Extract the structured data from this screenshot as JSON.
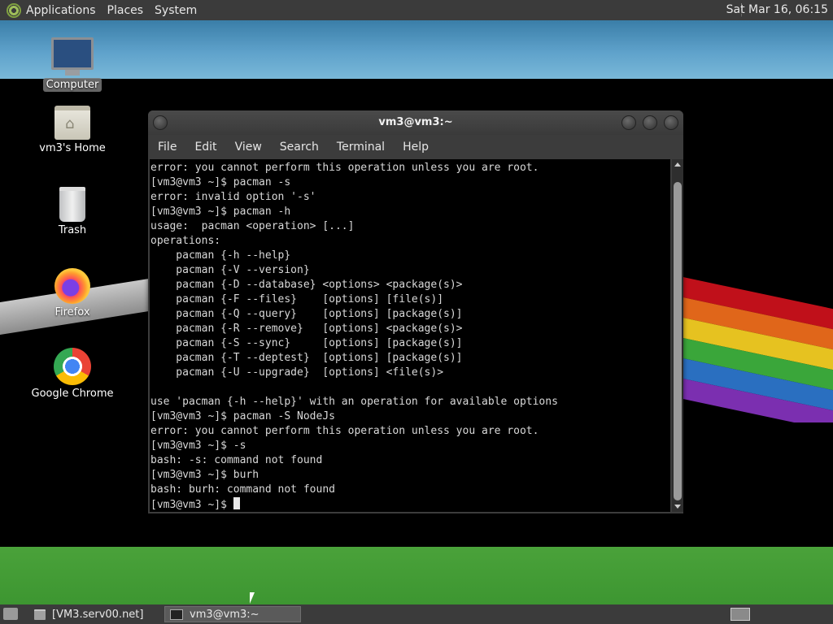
{
  "top_panel": {
    "menus": [
      "Applications",
      "Places",
      "System"
    ],
    "clock": "Sat Mar 16, 06:15"
  },
  "desktop_icons": [
    {
      "label": "Computer",
      "icon": "computer-icon",
      "selected": true
    },
    {
      "label": "vm3's Home",
      "icon": "home-folder-icon",
      "selected": false
    },
    {
      "label": "Trash",
      "icon": "trash-icon",
      "selected": false
    },
    {
      "label": "Firefox",
      "icon": "firefox-icon",
      "selected": false
    },
    {
      "label": "Google Chrome",
      "icon": "chrome-icon",
      "selected": false
    }
  ],
  "terminal": {
    "title": "vm3@vm3:~",
    "menu": [
      "File",
      "Edit",
      "View",
      "Search",
      "Terminal",
      "Help"
    ],
    "lines": [
      "error: you cannot perform this operation unless you are root.",
      "[vm3@vm3 ~]$ pacman -s",
      "error: invalid option '-s'",
      "[vm3@vm3 ~]$ pacman -h",
      "usage:  pacman <operation> [...]",
      "operations:",
      "    pacman {-h --help}",
      "    pacman {-V --version}",
      "    pacman {-D --database} <options> <package(s)>",
      "    pacman {-F --files}    [options] [file(s)]",
      "    pacman {-Q --query}    [options] [package(s)]",
      "    pacman {-R --remove}   [options] <package(s)>",
      "    pacman {-S --sync}     [options] [package(s)]",
      "    pacman {-T --deptest}  [options] [package(s)]",
      "    pacman {-U --upgrade}  [options] <file(s)>",
      "",
      "use 'pacman {-h --help}' with an operation for available options",
      "[vm3@vm3 ~]$ pacman -S NodeJs",
      "error: you cannot perform this operation unless you are root.",
      "[vm3@vm3 ~]$ -s",
      "bash: -s: command not found",
      "[vm3@vm3 ~]$ burh",
      "bash: burh: command not found"
    ],
    "prompt": "[vm3@vm3 ~]$ "
  },
  "taskbar": {
    "tasks": [
      "[VM3.serv00.net]",
      "vm3@vm3:~"
    ]
  }
}
